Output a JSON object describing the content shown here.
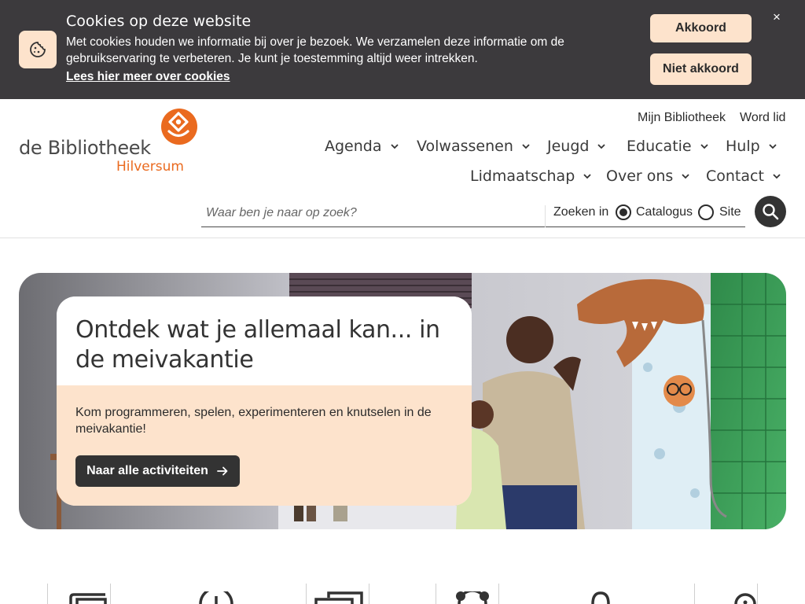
{
  "cookie": {
    "title": "Cookies op deze website",
    "text": "Met cookies houden we informatie bij over je bezoek. We verzamelen deze informatie om de gebruikservaring te verbeteren. Je kunt je toestemming altijd weer intrekken.",
    "link": "Lees hier meer over cookies",
    "accept": "Akkoord",
    "decline": "Niet akkoord",
    "close": "×",
    "icon": "cookie-icon"
  },
  "logo": {
    "main": "de Bibliotheek",
    "sub": "Hilversum"
  },
  "utility": {
    "account": "Mijn Bibliotheek",
    "join": "Word lid"
  },
  "nav": {
    "row1": [
      "Agenda",
      "Volwassenen",
      "Jeugd",
      "Educatie",
      "Hulp"
    ],
    "row2": [
      "Lidmaatschap",
      "Over ons",
      "Contact"
    ]
  },
  "search": {
    "placeholder": "Waar ben je naar op zoek?",
    "scope_label": "Zoeken in",
    "options": [
      "Catalogus",
      "Site"
    ],
    "selected": "Catalogus"
  },
  "hero": {
    "title": "Ontdek wat je allemaal kan... in de meivakantie",
    "text": "Kom programmeren, spelen, experimenteren en knutselen in de meivakantie!",
    "button": "Naar alle activiteiten"
  },
  "colors": {
    "cookie_bg": "#3c3a3d",
    "accent_peach": "#fde3cc",
    "brand_orange": "#ea6a1f",
    "dark": "#333333"
  }
}
